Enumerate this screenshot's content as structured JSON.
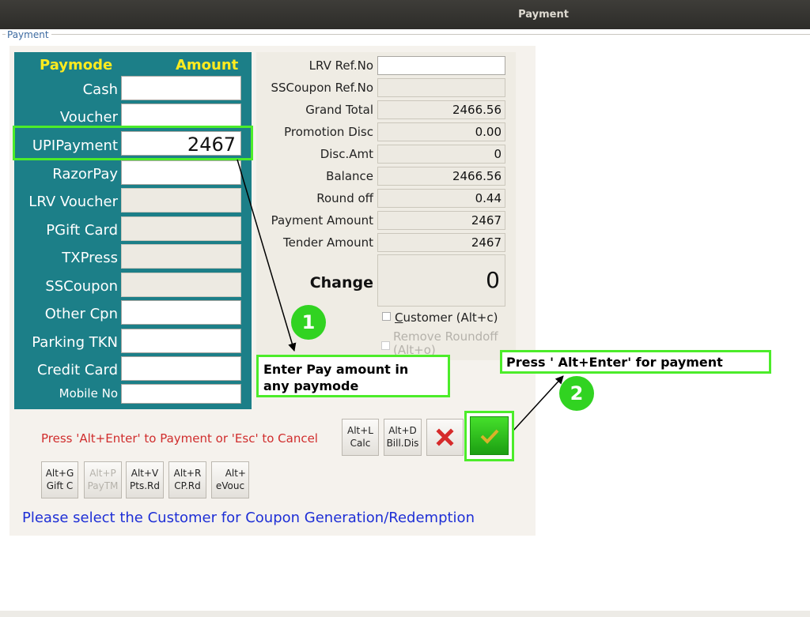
{
  "window": {
    "title": "Payment"
  },
  "group_label": "Payment",
  "paymodes": {
    "header_paymode": "Paymode",
    "header_amount": "Amount",
    "rows": [
      {
        "label": "Cash",
        "value": ""
      },
      {
        "label": "Voucher",
        "value": ""
      },
      {
        "label": "UPIPayment",
        "value": "2467"
      },
      {
        "label": "RazorPay",
        "value": ""
      },
      {
        "label": "LRV Voucher",
        "value": ""
      },
      {
        "label": "PGift Card",
        "value": ""
      },
      {
        "label": "TXPress",
        "value": ""
      },
      {
        "label": "SSCoupon",
        "value": ""
      },
      {
        "label": "Other Cpn",
        "value": ""
      },
      {
        "label": "Parking TKN",
        "value": ""
      },
      {
        "label": "Credit Card",
        "value": ""
      },
      {
        "label": "Mobile No",
        "value": ""
      }
    ]
  },
  "summary": {
    "lrv_ref_label": "LRV Ref.No",
    "lrv_ref_value": "",
    "sscoupon_ref_label": "SSCoupon Ref.No",
    "sscoupon_ref_value": "",
    "grand_total_label": "Grand Total",
    "grand_total_value": "2466.56",
    "promotion_disc_label": "Promotion Disc",
    "promotion_disc_value": "0.00",
    "disc_amt_label": "Disc.Amt",
    "disc_amt_value": "0",
    "balance_label": "Balance",
    "balance_value": "2466.56",
    "round_off_label": "Round off",
    "round_off_value": "0.44",
    "payment_amount_label": "Payment Amount",
    "payment_amount_value": "2467",
    "tender_amount_label": "Tender Amount",
    "tender_amount_value": "2467",
    "change_label": "Change",
    "change_value": "0"
  },
  "checkboxes": {
    "customer_prefix": "C",
    "customer_rest": "ustomer (Alt+c)",
    "remove_roundoff": "Remove Roundoff",
    "remove_roundoff_key": "(Alt+o)"
  },
  "annotations": {
    "step1_number": "1",
    "step1_line1": "Enter Pay amount in",
    "step1_line2": "any paymode",
    "step2_number": "2",
    "step2_text": "Press ' Alt+Enter' for payment"
  },
  "hint": "Press 'Alt+Enter' to Payment or 'Esc' to Cancel",
  "buttons": {
    "calc_key": "Alt+L",
    "calc_label": "Calc",
    "billdisc_key": "Alt+D",
    "billdisc_label": "Bill.Dis",
    "giftc_key": "Alt+G",
    "giftc_label": "Gift C",
    "paytm_key": "Alt+P",
    "paytm_label": "PayTM",
    "ptsrd_key": "Alt+V",
    "ptsrd_label": "Pts.Rd",
    "cprd_key": "Alt+R",
    "cprd_label": "CP.Rd",
    "evouc_key": "Alt+",
    "evouc_label": "eVouc"
  },
  "customer_message": "Please select the Customer for Coupon Generation/Redemption",
  "colors": {
    "panel_teal": "#1c7f88",
    "header_yellow": "#ffeb1f",
    "highlight_green": "#4cec2a",
    "hint_red": "#d02d2d",
    "message_blue": "#1e2fd6"
  }
}
